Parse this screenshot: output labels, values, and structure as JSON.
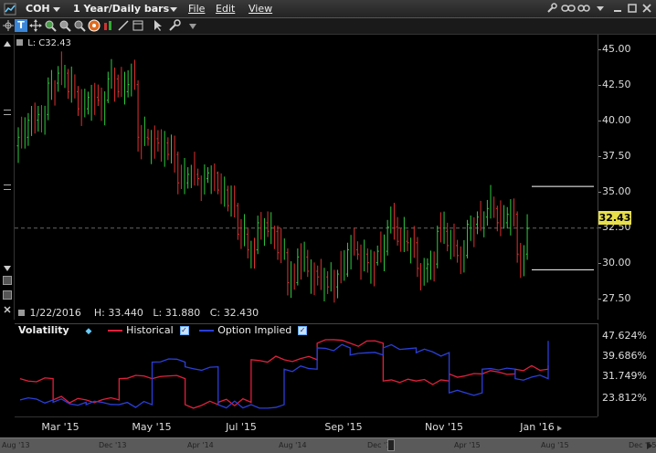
{
  "titlebar": {
    "symbol": "COH",
    "timeframe": "1 Year/Daily bars",
    "menu_file": "File",
    "menu_edit": "Edit",
    "menu_view": "View"
  },
  "chart": {
    "last_label": "L: C32.43",
    "last_price": "32.43",
    "ohlc": {
      "date": "1/22/2016",
      "high": "H: 33.440",
      "low": "L: 31.880",
      "close": "C: 32.430"
    },
    "price_ticks": [
      "45.00",
      "42.50",
      "40.00",
      "37.50",
      "35.00",
      "32.50",
      "30.00",
      "27.50"
    ],
    "x_ticks": [
      "Mar '15",
      "May '15",
      "Jul '15",
      "Sep '15",
      "Nov '15",
      "Jan '16"
    ]
  },
  "volatility": {
    "title": "Volatility",
    "historical_label": "Historical",
    "implied_label": "Option Implied",
    "ticks": [
      "47.624%",
      "39.686%",
      "31.749%",
      "23.812%"
    ],
    "historical_color": "#e0203c",
    "implied_color": "#2a3fd8"
  },
  "scrollbar": {
    "labels": [
      "Aug '13",
      "Dec '13",
      "Apr '14",
      "Aug '14",
      "Dec '14",
      "Apr '15",
      "Aug '15",
      "Dec '15"
    ]
  },
  "chart_data": {
    "type": "line",
    "title": "",
    "series": [
      {
        "name": "Historical",
        "values": [
          34,
          25,
          25,
          34,
          34,
          23,
          24,
          42,
          42,
          49,
          49,
          33,
          33,
          36,
          36,
          38,
          39
        ]
      },
      {
        "name": "Option Implied",
        "values": [
          25,
          24,
          23,
          23,
          41,
          39,
          23,
          23,
          38,
          47,
          44,
          47,
          45,
          28,
          38,
          34,
          49
        ]
      }
    ],
    "candles": [
      [
        0,
        38.2,
        39.5,
        37.0,
        38.8
      ],
      [
        3,
        38.8,
        40.5,
        38.2,
        40.0
      ],
      [
        6,
        40.0,
        41.0,
        39.2,
        40.4
      ],
      [
        9,
        40.4,
        43.0,
        40.0,
        42.6
      ],
      [
        12,
        42.6,
        43.8,
        42.0,
        43.3
      ],
      [
        15,
        43.3,
        43.6,
        41.5,
        42.0
      ],
      [
        18,
        42.0,
        42.4,
        40.3,
        40.8
      ],
      [
        21,
        40.8,
        42.0,
        40.4,
        41.6
      ],
      [
        24,
        41.6,
        42.5,
        41.0,
        41.4
      ],
      [
        27,
        41.4,
        43.4,
        41.2,
        42.9
      ],
      [
        30,
        42.9,
        43.2,
        41.6,
        42.0
      ],
      [
        33,
        42.0,
        43.5,
        41.6,
        42.5
      ],
      [
        36,
        42.5,
        42.8,
        37.8,
        38.8
      ],
      [
        39,
        38.8,
        39.4,
        38.2,
        38.7
      ],
      [
        42,
        38.7,
        39.3,
        37.8,
        38.4
      ],
      [
        45,
        38.4,
        38.8,
        37.2,
        37.6
      ],
      [
        48,
        37.6,
        37.8,
        34.8,
        35.6
      ],
      [
        51,
        35.6,
        36.7,
        35.2,
        36.2
      ],
      [
        54,
        36.2,
        36.6,
        35.4,
        35.9
      ],
      [
        57,
        35.9,
        36.7,
        35.6,
        36.3
      ],
      [
        60,
        36.3,
        36.4,
        34.8,
        35.1
      ],
      [
        63,
        35.1,
        35.4,
        33.6,
        34.0
      ],
      [
        66,
        34.0,
        34.2,
        31.6,
        32.0
      ],
      [
        69,
        32.0,
        32.4,
        30.3,
        30.9
      ],
      [
        72,
        30.9,
        33.3,
        30.6,
        32.8
      ],
      [
        75,
        32.8,
        33.6,
        31.8,
        32.2
      ],
      [
        78,
        32.2,
        32.6,
        30.2,
        30.7
      ],
      [
        81,
        30.7,
        31.0,
        27.7,
        28.6
      ],
      [
        84,
        28.6,
        31.0,
        28.4,
        30.4
      ],
      [
        87,
        30.4,
        30.9,
        29.0,
        29.4
      ],
      [
        90,
        29.4,
        29.8,
        28.4,
        29.0
      ],
      [
        93,
        29.0,
        29.4,
        27.8,
        28.3
      ],
      [
        96,
        28.3,
        29.5,
        27.5,
        29.2
      ],
      [
        99,
        29.2,
        31.4,
        29.0,
        30.9
      ],
      [
        102,
        30.9,
        31.5,
        30.2,
        30.6
      ],
      [
        105,
        30.6,
        31.0,
        29.3,
        30.0
      ],
      [
        108,
        30.0,
        31.2,
        29.8,
        30.8
      ],
      [
        111,
        30.8,
        33.0,
        30.5,
        32.5
      ],
      [
        114,
        32.5,
        33.2,
        31.2,
        31.5
      ],
      [
        117,
        31.5,
        32.3,
        30.8,
        31.4
      ],
      [
        120,
        31.4,
        31.8,
        29.0,
        29.6
      ],
      [
        123,
        29.6,
        30.3,
        28.6,
        29.9
      ],
      [
        126,
        29.9,
        32.6,
        29.6,
        32.2
      ],
      [
        129,
        32.2,
        32.8,
        30.8,
        31.2
      ],
      [
        132,
        31.2,
        31.6,
        30.0,
        30.5
      ],
      [
        135,
        30.5,
        33.0,
        30.3,
        32.7
      ],
      [
        138,
        32.7,
        33.6,
        32.0,
        33.2
      ],
      [
        141,
        33.2,
        34.4,
        32.6,
        33.8
      ],
      [
        144,
        33.8,
        34.0,
        32.2,
        32.8
      ],
      [
        147,
        32.8,
        33.9,
        32.4,
        33.4
      ],
      [
        150,
        33.4,
        33.6,
        30.0,
        30.6
      ],
      [
        153,
        30.6,
        33.4,
        30.2,
        32.4
      ]
    ],
    "price_ylim": [
      26.0,
      46.0
    ],
    "vol_ylim": [
      18,
      52
    ],
    "x_range": [
      0,
      156
    ]
  }
}
